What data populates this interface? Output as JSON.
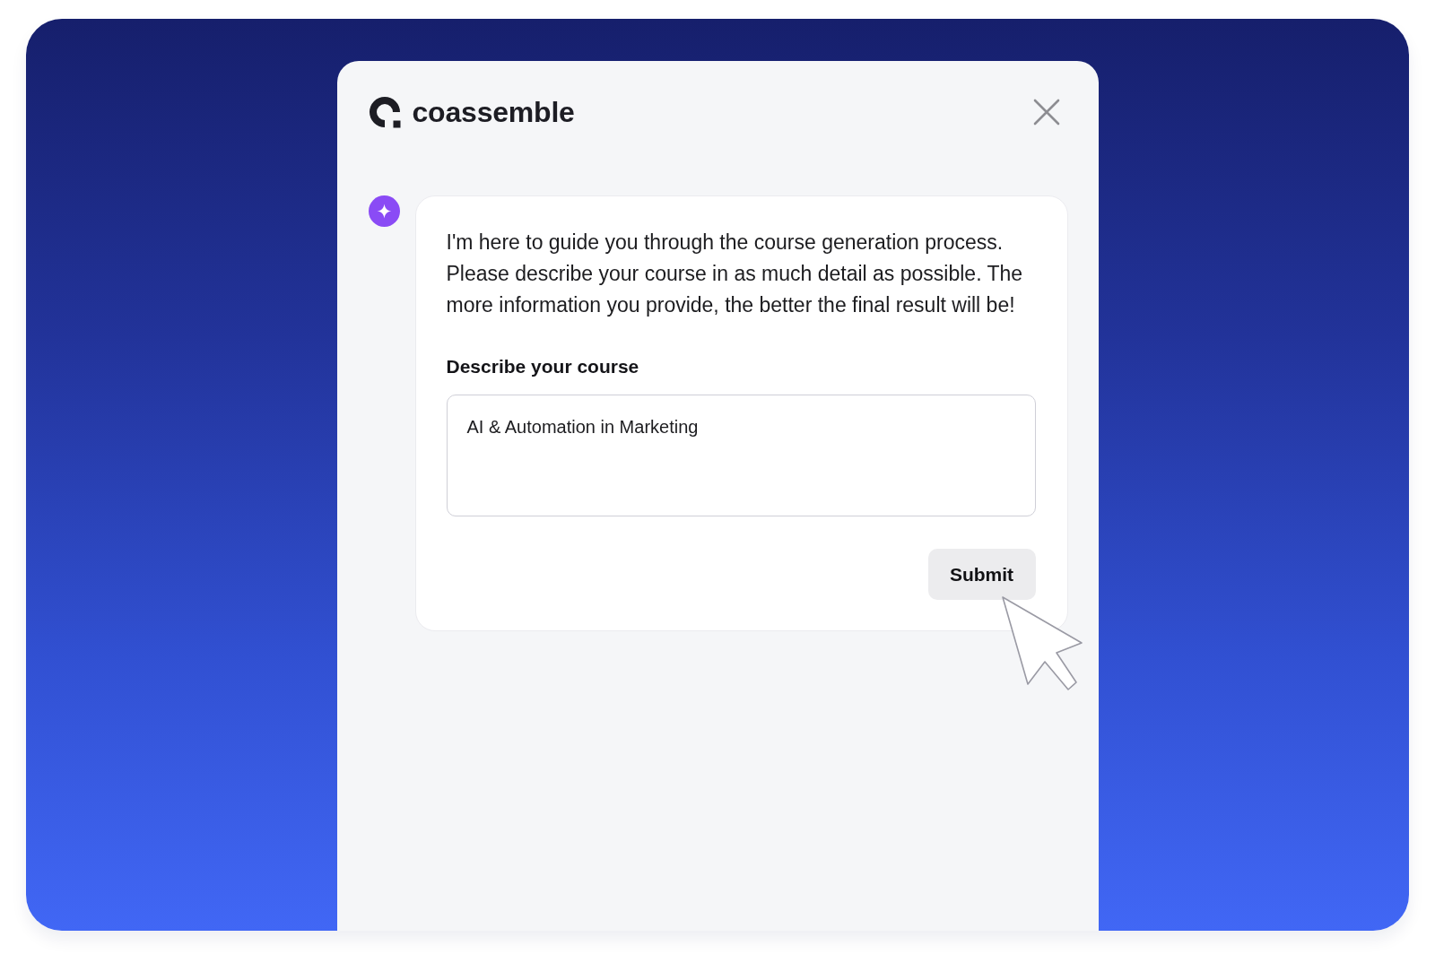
{
  "logo": {
    "wordmark": "coassemble"
  },
  "message": {
    "text": "I'm here to guide you through the course generation process. Please describe your course in as much detail as possible. The more information you provide, the better the final result will be!"
  },
  "form": {
    "label": "Describe your course",
    "value": "AI & Automation in Marketing",
    "submit": "Submit"
  }
}
